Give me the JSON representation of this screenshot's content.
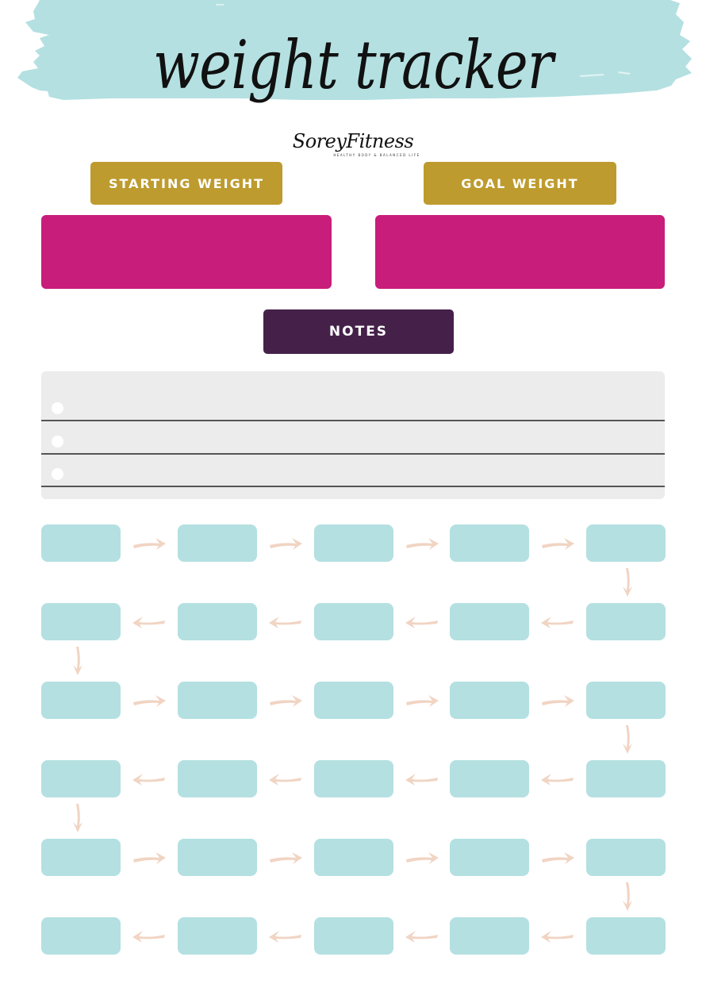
{
  "header": {
    "title": "weight tracker",
    "brand_name": "SoreyFitness",
    "brand_tagline": "HEALTHY BODY & BALANCED LIFE"
  },
  "colors": {
    "brush_teal": "#b4e0e1",
    "gold": "#bd9b2e",
    "magenta": "#c81d7a",
    "plum": "#45214a",
    "notes_bg": "#ececec",
    "cell_teal": "#b4e0e1",
    "arrow_peach": "#f1d4c3"
  },
  "starting_weight": {
    "label": "STARTING WEIGHT",
    "value": ""
  },
  "goal_weight": {
    "label": "GOAL WEIGHT",
    "value": ""
  },
  "notes": {
    "label": "NOTES",
    "lines": [
      "",
      "",
      ""
    ]
  },
  "tracker": {
    "rows": 6,
    "columns": 5,
    "entries": [
      [
        "",
        "",
        "",
        "",
        ""
      ],
      [
        "",
        "",
        "",
        "",
        ""
      ],
      [
        "",
        "",
        "",
        "",
        ""
      ],
      [
        "",
        "",
        "",
        "",
        ""
      ],
      [
        "",
        "",
        "",
        "",
        ""
      ],
      [
        "",
        "",
        "",
        "",
        ""
      ]
    ],
    "flow": "serpentine"
  }
}
